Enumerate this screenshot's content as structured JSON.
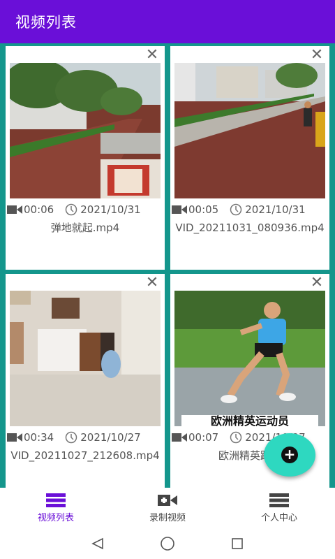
{
  "app": {
    "title": "视频列表"
  },
  "videos": [
    {
      "duration": "00:06",
      "date": "2021/10/31",
      "filename": "弹地就起.mp4"
    },
    {
      "duration": "00:05",
      "date": "2021/10/31",
      "filename": "VID_20211031_080936.mp4"
    },
    {
      "duration": "00:34",
      "date": "2021/10/27",
      "filename": "VID_20211027_212608.mp4"
    },
    {
      "duration": "00:07",
      "date": "2021/10/27",
      "filename": "欧洲精英跑者",
      "overlay_text": "欧洲精英运动员"
    }
  ],
  "close_glyph": "✕",
  "fab": {
    "icon": "plus-icon",
    "glyph": "+"
  },
  "bottom_nav": [
    {
      "label": "视频列表",
      "icon": "list-icon",
      "active": true
    },
    {
      "label": "录制视频",
      "icon": "video-camera-icon",
      "active": false
    },
    {
      "label": "个人中心",
      "icon": "menu-icon",
      "active": false
    }
  ],
  "colors": {
    "appbar": "#6a0fd8",
    "background": "#14968c",
    "fab": "#2ed8c0",
    "active_nav": "#6a0fd8"
  }
}
